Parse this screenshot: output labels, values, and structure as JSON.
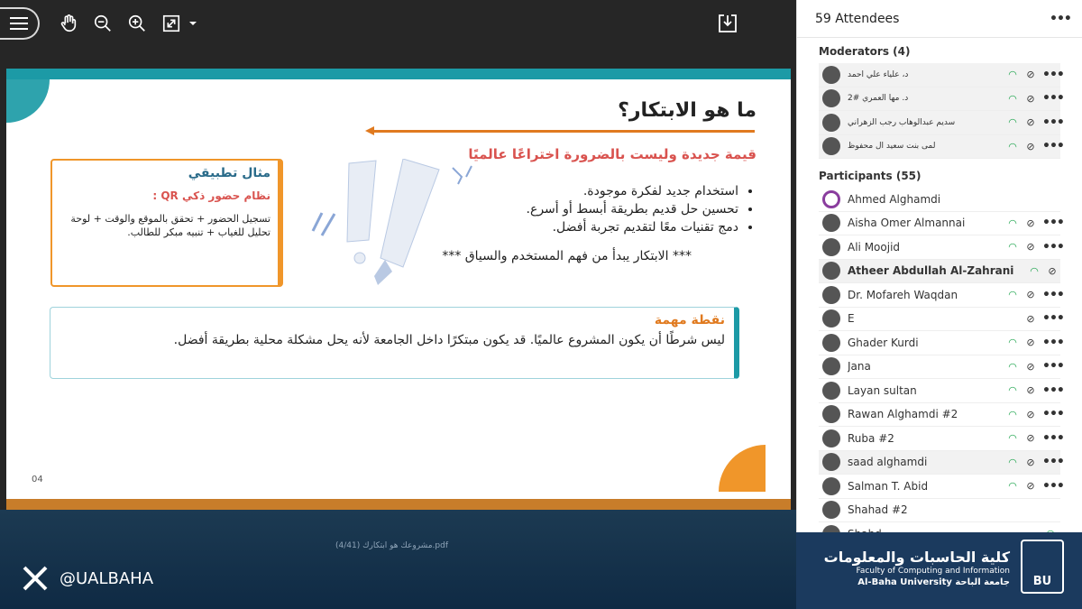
{
  "toolbar": {
    "menu_label": "Menu"
  },
  "slide": {
    "title": "ما هو الابتكار؟",
    "subtitle": "قيمة جديدة وليست بالضرورة اختراعًا عالميًا",
    "bullets": [
      "استخدام جديد لفكرة موجودة.",
      "تحسين حل قديم بطريقة أبسط أو أسرع.",
      "دمج تقنيات معًا لتقديم تجربة أفضل."
    ],
    "bullet_note": "*** الابتكار يبدأ من فهم المستخدم والسياق ***",
    "example_title": "مثال تطبيقي",
    "example_sub": "نظام حضور ذكي QR :",
    "example_text": "تسجيل الحضور + تحقق بالموقع والوقت + لوحة تحليل للغياب + تنبيه مبكر للطالب.",
    "note_title": "نقطة مهمة",
    "note_text": "ليس شرطًا أن يكون المشروع عالميًا. قد يكون مبتكرًا داخل الجامعة لأنه يحل مشكلة محلية بطريقة أفضل.",
    "page_number": "04"
  },
  "presentation": {
    "file_label": "(4/41)  مشروعك هو ابتكارك.pdf"
  },
  "social": {
    "handle": "@UALBAHA"
  },
  "panel": {
    "title": "59 Attendees",
    "moderators_title": "Moderators (4)",
    "moderators": [
      {
        "name": "د، علياء علي أحمد"
      },
      {
        "name": "د. مها العمري #2"
      },
      {
        "name": "سديم عبدالوهاب رجب الزهراني"
      },
      {
        "name": "لمى بنت سعيد آل محفوظ"
      }
    ],
    "participants_title": "Participants (55)",
    "participants": [
      {
        "name": "Ahmed Alghamdi"
      },
      {
        "name": "Aisha Omer Almannai"
      },
      {
        "name": "Ali Moojid"
      },
      {
        "name": "Atheer Abdullah Al-Zahrani"
      },
      {
        "name": "Dr. Mofareh Waqdan"
      },
      {
        "name": "E"
      },
      {
        "name": "Ghader Kurdi"
      },
      {
        "name": "Jana"
      },
      {
        "name": "Layan sultan"
      },
      {
        "name": "Rawan Alghamdi #2"
      },
      {
        "name": "Ruba #2"
      },
      {
        "name": "saad alghamdi"
      },
      {
        "name": "Salman T. Abid"
      },
      {
        "name": "Shahad #2"
      },
      {
        "name": "Shahd"
      }
    ]
  },
  "logo": {
    "arabic": "كلية الحاسبات والمعلومات",
    "english1": "Faculty of Computing and Information",
    "english2": "Al-Baha University  جامعة الباحة",
    "mark": "BU"
  },
  "colors": {
    "teal": "#1c9aa6",
    "orange": "#f0962a",
    "red": "#d9534f",
    "signal_green": "#1aa34a"
  }
}
